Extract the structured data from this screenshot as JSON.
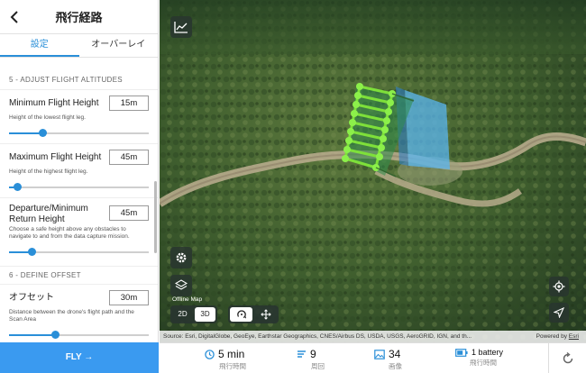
{
  "header": {
    "title": "飛行経路"
  },
  "tabs": [
    {
      "label": "設定",
      "active": true
    },
    {
      "label": "オーバーレイ",
      "active": false
    }
  ],
  "sections": {
    "altitudes": "5 - ADJUST FLIGHT ALTITUDES",
    "offset": "6 - DEFINE OFFSET"
  },
  "settings": {
    "min_height": {
      "label": "Minimum Flight Height",
      "value": "15m",
      "help": "Height of the lowest flight leg.",
      "level": 0.24
    },
    "max_height": {
      "label": "Maximum Flight Height",
      "value": "45m",
      "help": "Height of the highest flight leg.",
      "level": 0.06
    },
    "departure": {
      "label": "Departure/Minimum Return Height",
      "value": "45m",
      "help": "Choose a safe height above any obstacles to navigate to and from the data capture mission.",
      "level": 0.16
    },
    "offset": {
      "label": "オフセット",
      "value": "30m",
      "help": "Distance between the drone's flight path and the Scan Area",
      "level": 0.33
    }
  },
  "fly_button": {
    "label": "FLY →"
  },
  "map": {
    "offline_label": "Offline Map",
    "view_2d": "2D",
    "view_3d": "3D",
    "active_view": "3D",
    "attribution": "Source: Esri, DigitalGlobe, GeoEye, Earthstar Geographics, CNES/Airbus DS, USDA, USGS, AeroGRID, IGN, and th...",
    "powered_by": "Powered by",
    "powered_by_brand": "Esri",
    "icons": [
      "chart-icon",
      "gear-icon",
      "layers-icon",
      "orbit-icon",
      "move-icon",
      "locate-icon",
      "navigation-arrow-icon"
    ]
  },
  "stats": [
    {
      "icon": "clock-icon",
      "value": "5 min",
      "label": "飛行時間"
    },
    {
      "icon": "legs-icon",
      "value": "9",
      "label": "周回"
    },
    {
      "icon": "image-icon",
      "value": "34",
      "label": "画像"
    },
    {
      "icon": "battery-icon",
      "value": "1 battery",
      "label": "飛行時間"
    }
  ],
  "colors": {
    "accent": "#2a8fd8",
    "fly_button": "#3a9af0",
    "path_green": "#7ee03a"
  }
}
